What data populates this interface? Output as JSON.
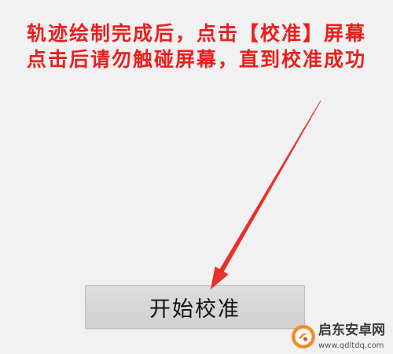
{
  "screen": {
    "background": "#f1f1f1"
  },
  "instructions": {
    "line1": "轨迹绘制完成后，点击【校准】屏幕",
    "line2": "点击后请勿触碰屏幕，直到校准成功",
    "color": "#e8201e"
  },
  "arrow": {
    "color": "#e8302a"
  },
  "calibrate_button": {
    "label": "开始校准"
  },
  "watermark": {
    "icon": "qidong-logo-icon",
    "name": "启东安卓网",
    "url": "www.qdltdq.com"
  }
}
